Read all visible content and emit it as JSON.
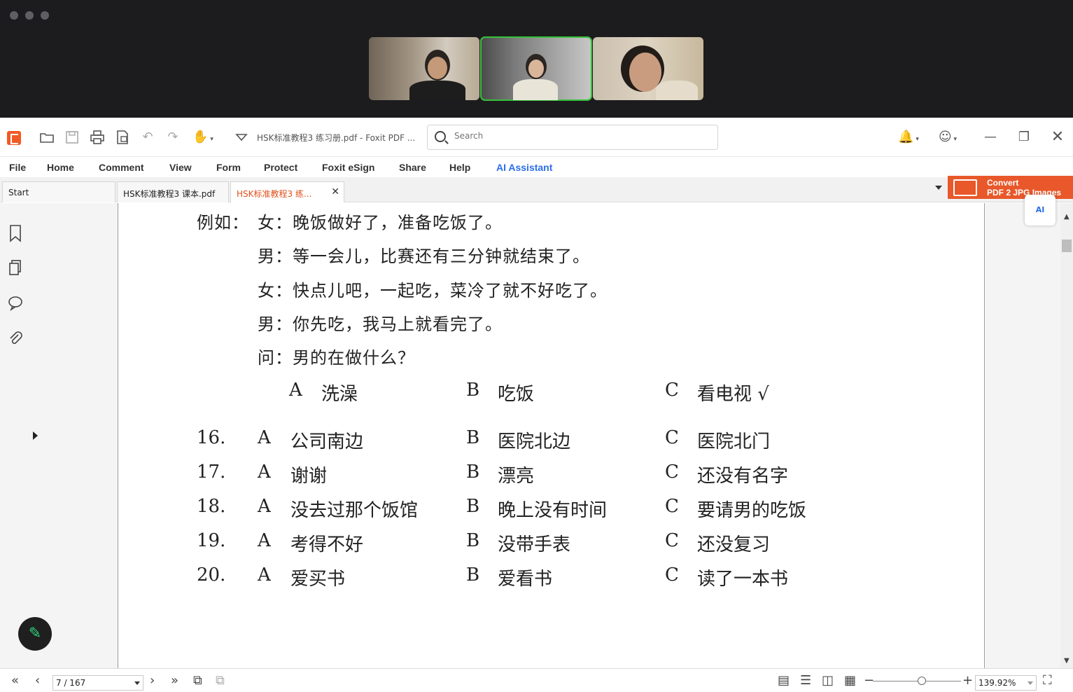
{
  "call": {
    "participants": [
      "participant-1",
      "participant-2",
      "participant-3"
    ]
  },
  "toolbar": {
    "doc_title": "HSK标准教程3 练习册.pdf - Foxit PDF ...",
    "search_placeholder": "Search"
  },
  "menu": [
    "File",
    "Home",
    "Comment",
    "View",
    "Form",
    "Protect",
    "Foxit eSign",
    "Share",
    "Help",
    "AI Assistant"
  ],
  "tabs": [
    {
      "label": "Start"
    },
    {
      "label": "HSK标准教程3 课本.pdf"
    },
    {
      "label": "HSK标准教程3 练..."
    }
  ],
  "convert": {
    "line1": "Convert",
    "line2": "PDF 2 JPG Images"
  },
  "ai_bubble": "AI",
  "page": {
    "example_label": "例如：",
    "dialogue": [
      "女：晚饭做好了，准备吃饭了。",
      "男：等一会儿，比赛还有三分钟就结束了。",
      "女：快点儿吧，一起吃，菜冷了就不好吃了。",
      "男：你先吃，我马上就看完了。",
      "问：男的在做什么？"
    ],
    "example_options": {
      "a_letter": "A",
      "a_text": "洗澡",
      "b_letter": "B",
      "b_text": "吃饭",
      "c_letter": "C",
      "c_text": "看电视 √"
    },
    "questions": [
      {
        "num": "16.",
        "a": "公司南边",
        "b": "医院北边",
        "c": "医院北门"
      },
      {
        "num": "17.",
        "a": "谢谢",
        "b": "漂亮",
        "c": "还没有名字"
      },
      {
        "num": "18.",
        "a": "没去过那个饭馆",
        "b": "晚上没有时间",
        "c": "要请男的吃饭"
      },
      {
        "num": "19.",
        "a": "考得不好",
        "b": "没带手表",
        "c": "还没复习"
      },
      {
        "num": "20.",
        "a": "爱买书",
        "b": "爱看书",
        "c": "读了一本书"
      }
    ],
    "letters": {
      "a": "A",
      "b": "B",
      "c": "C"
    }
  },
  "status": {
    "page_indicator": "7 / 167",
    "zoom": "139.92%"
  },
  "colors": {
    "accent": "#e8582a",
    "active_tab": "#e0501b",
    "ai": "#2b6ee8",
    "active_speaker": "#36c23c"
  },
  "icons": {
    "logo": "foxit-logo-icon",
    "open": "folder-open-icon",
    "save": "save-icon",
    "print": "print-icon",
    "bookmark": "bookmark-icon",
    "pen": "pen-icon"
  }
}
